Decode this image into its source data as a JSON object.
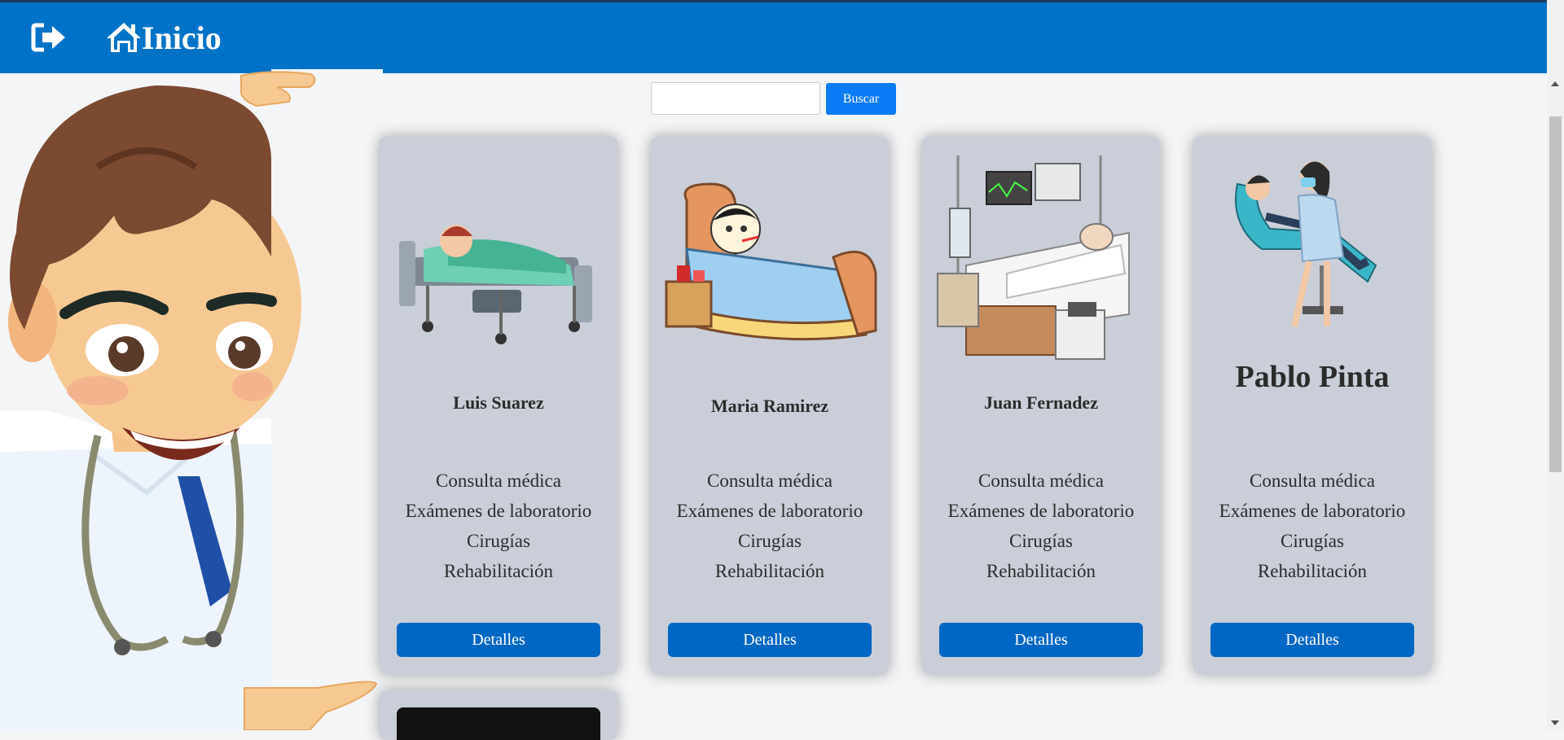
{
  "navbar": {
    "logout_icon": "logout-icon",
    "home_icon": "home-icon",
    "title": "Inicio"
  },
  "search": {
    "value": "",
    "button_label": "Buscar"
  },
  "cards": [
    {
      "name": "Luis Suarez",
      "image": "child-in-hospital-bed-illustration",
      "services": [
        "Consulta médica",
        "Exámenes de laboratorio",
        "Cirugías",
        "Rehabilitación"
      ],
      "button_label": "Detalles"
    },
    {
      "name": "Maria Ramirez",
      "image": "sick-boy-in-bed-illustration",
      "services": [
        "Consulta médica",
        "Exámenes de laboratorio",
        "Cirugías",
        "Rehabilitación"
      ],
      "button_label": "Detalles"
    },
    {
      "name": "Juan Fernadez",
      "image": "elderly-patient-icu-illustration",
      "services": [
        "Consulta médica",
        "Exámenes de laboratorio",
        "Cirugías",
        "Rehabilitación"
      ],
      "button_label": "Detalles"
    },
    {
      "name": "Pablo Pinta",
      "image": "dentist-patient-illustration",
      "services": [
        "Consulta médica",
        "Exámenes de laboratorio",
        "Cirugías",
        "Rehabilitación"
      ],
      "button_label": "Detalles"
    }
  ],
  "colors": {
    "navbar": "#0073c8",
    "card": "#c9ced8",
    "button": "#0068c4",
    "search_button": "#0a7bf5"
  }
}
